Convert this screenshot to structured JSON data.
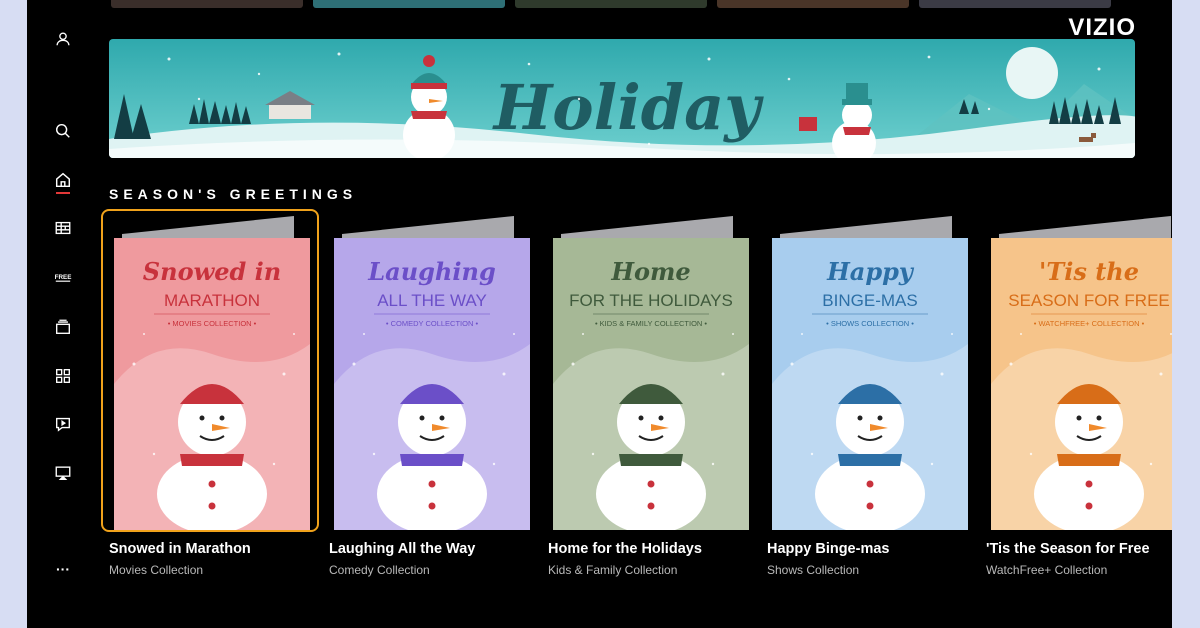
{
  "brand": {
    "logo": "VIZIO"
  },
  "banner": {
    "title": "Holiday"
  },
  "section": {
    "title": "SEASON'S GREETINGS"
  },
  "sidebar": {
    "items": [
      {
        "name": "profile-icon"
      },
      {
        "name": "search-icon"
      },
      {
        "name": "home-icon",
        "active": true
      },
      {
        "name": "guide-icon"
      },
      {
        "name": "free-icon",
        "label": "FREE"
      },
      {
        "name": "library-icon"
      },
      {
        "name": "apps-icon"
      },
      {
        "name": "feedback-icon"
      },
      {
        "name": "cast-icon"
      },
      {
        "name": "more-icon",
        "label": "···"
      }
    ]
  },
  "cards": [
    {
      "art_line1": "Snowed",
      "art_small": "in",
      "art_line2": "MARATHON",
      "art_tag": "• MOVIES COLLECTION •",
      "title": "Snowed in Marathon",
      "subtitle": "Movies Collection",
      "bg": "#ef9a9e",
      "accent": "#c8323c",
      "focused": true
    },
    {
      "art_line1": "Laughing",
      "art_line2": "ALL THE WAY",
      "art_tag": "• COMEDY COLLECTION •",
      "title": "Laughing All the Way",
      "subtitle": "Comedy Collection",
      "bg": "#b6a7ea",
      "accent": "#6b4fc8"
    },
    {
      "art_line1": "Home",
      "art_line2": "FOR THE HOLIDAYS",
      "art_tag": "• KIDS & FAMILY COLLECTION •",
      "title": "Home for the Holidays",
      "subtitle": "Kids & Family Collection",
      "bg": "#a6b896",
      "accent": "#3f5a3c"
    },
    {
      "art_line1": "Happy",
      "art_line2": "BINGE-MAS",
      "art_tag": "• SHOWS COLLECTION •",
      "title": "Happy Binge-mas",
      "subtitle": "Shows Collection",
      "bg": "#a8cdee",
      "accent": "#2c6fa6"
    },
    {
      "art_line1": "'Tis the",
      "art_line2": "SEASON FOR FREE",
      "art_tag": "• WATCHFREE+ COLLECTION •",
      "title": "'Tis the Season for Free",
      "subtitle": "WatchFree+ Collection",
      "bg": "#f6c48a",
      "accent": "#d86d18"
    }
  ]
}
